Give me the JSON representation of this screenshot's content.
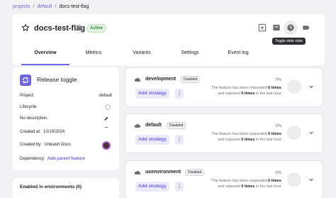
{
  "breadcrumb": {
    "items": [
      "projects",
      "default"
    ],
    "current": "docs-test-flag"
  },
  "header": {
    "title": "docs-test-flag",
    "status": "Active",
    "tooltip": "Toggle state state",
    "tabs": [
      "Overview",
      "Metrics",
      "Variants",
      "Settings",
      "Event log"
    ]
  },
  "sidebar": {
    "title": "Release toggle",
    "project_label": "Project:",
    "project_value": "default",
    "lifecycle_label": "Lifecycle:",
    "description": "No description.",
    "created_at_label": "Created at:",
    "created_at_value": "10/10/2024",
    "created_by_label": "Created by:",
    "created_by_value": "Unleash Docs",
    "dependency_label": "Dependency:",
    "dependency_link": "Add parent feature"
  },
  "environments_card": {
    "title": "Enabled in environments (0)"
  },
  "environments": [
    {
      "name": "development",
      "status": "Disabled",
      "add_strategy": "Add strategy",
      "percent": "0%",
      "desc_1": "The feature has been requested",
      "desc_times_1": "0 times",
      "desc_2": "and exposed",
      "desc_times_2": "0 times",
      "desc_3": "in the last hour"
    },
    {
      "name": "default",
      "status": "Disabled",
      "add_strategy": "Add strategy",
      "percent": "0%",
      "desc_1": "The feature has been requested",
      "desc_times_1": "0 times",
      "desc_2": "and exposed",
      "desc_times_2": "0 times",
      "desc_3": "in the last hour"
    },
    {
      "name": "uxenvironment",
      "status": "Disabled",
      "add_strategy": "Add strategy",
      "percent": "0%",
      "desc_1": "The feature has been requested",
      "desc_times_1": "0 times",
      "desc_2": "and exposed",
      "desc_times_2": "0 times",
      "desc_3": "in the last hour"
    }
  ],
  "colors": {
    "accent": "#6c65e5",
    "background": "#f2f2f5",
    "active_green": "#2e8c3a"
  }
}
